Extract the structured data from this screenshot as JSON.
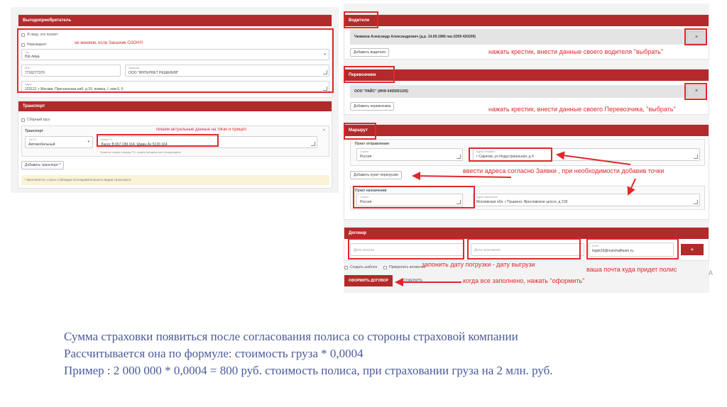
{
  "left": {
    "section_beneficiary": "Выгодоприобретатель",
    "chk_same": "Я лицо, кто платит",
    "chk_physical": "Нерезидент",
    "type_label": "Тип",
    "type_value": "Юр.лица",
    "inn_label": "ИНН",
    "inn_value": "7716277370",
    "name_label": "Название",
    "name_value": "ООО \"ИНТЕРНЕТ РЕШЕНИЯ\"",
    "address_label": "Адрес",
    "address_value": "123112, г Москва, Пресненская наб, д 10, помещ. I, ком 6, 6",
    "section_transport": "Транспорт",
    "chk_own_transport": "Сборный груз",
    "transport_header": "Транспорт",
    "vehicle_type_label": "Тип ТС",
    "vehicle_type_value": "Автомобильный",
    "vehicle_num_label": "Номер ТС",
    "vehicle_num_value": "Ланос В 657 ОМ 164, Шмиц Ау 5136 164",
    "vehicle_hint": "Укажите номер и марку ТС, номер прицепа или полуприцепа",
    "add_transport_btn": "Добавить транспорт *",
    "hint_bottom": "* Заполняется, строго соблюдая последовательность видов транспорта"
  },
  "right": {
    "section_drivers": "Водители",
    "driver_value": "Чижиков Александр Александрович (д.р. 14.09.1986 пас.6309 420209)",
    "x_symbol": "×",
    "add_driver_btn": "Добавить водителя",
    "section_carriers": "Перевозчики",
    "carrier_value": "ООО \"РАЙС\" (ИНН 6455051105)",
    "add_carrier_btn": "Добавить перевозчика",
    "section_route": "Маршрут",
    "departure_header": "Пункт отправления",
    "country_label": "Страна",
    "country_value": "Россия",
    "dep_address_label": "Адрес отправки",
    "dep_address_value": "г Саратов, ул Индустриальная, д 4",
    "add_transfer_btn": "Добавить пункт перегрузки",
    "destination_header": "Пункт назначения",
    "dest_country_label": "Страна",
    "dest_country_value": "Россия",
    "dest_address_label": "Адрес назначения",
    "dest_address_value": "Московская обл, г Пушкино, Ярославское шоссе, д 218",
    "section_contract": "Договор",
    "start_date_placeholder": "Дата начала",
    "end_date_placeholder": "Дата окончания",
    "email_label": "Email",
    "email_value": "logist10@marshallteam.ru",
    "plus_btn": "+",
    "chk_template": "Создать шаблон",
    "chk_attachment": "Прикрепить вложения",
    "submit_btn": "ОФОРМИТЬ ДОГОВОР",
    "cancel_btn": "× ОТМЕНИТЬ"
  },
  "annotations": {
    "no_change": "не меняем, если Заказчик ОЗОН!!!",
    "vehicle_note": "пишем актуальные данные на тягач и прицеп",
    "driver_note": "нажать крестик, внести данные своего водителя \"выбрать\"",
    "carrier_note": "нажать крестик, внести данные своего Перевозчика, \"выбрать\"",
    "address_note": "ввести адреса согласно Заявки , при необходимости добавив точки",
    "date_note": "запонить дату погрузки - дату выгрузи",
    "email_note": "ваша почта куда придет полис",
    "submit_note": "когда все заполнено, нажать \"оформить\""
  },
  "bottom_text": {
    "line1": "Сумма страховки появиться после согласования полиса со стороны страховой компании",
    "line2": "Рассчитывается она по формуле: стоимость груза * 0,0004",
    "line3": "Пример : 2 000 000 * 0,0004 = 800 руб. стоимость полиса, при страховании груза на 2 млн. руб."
  },
  "colors": {
    "accent": "#b22a2a",
    "annotation": "#e0282b",
    "bottom_text": "#4a5a9a"
  }
}
